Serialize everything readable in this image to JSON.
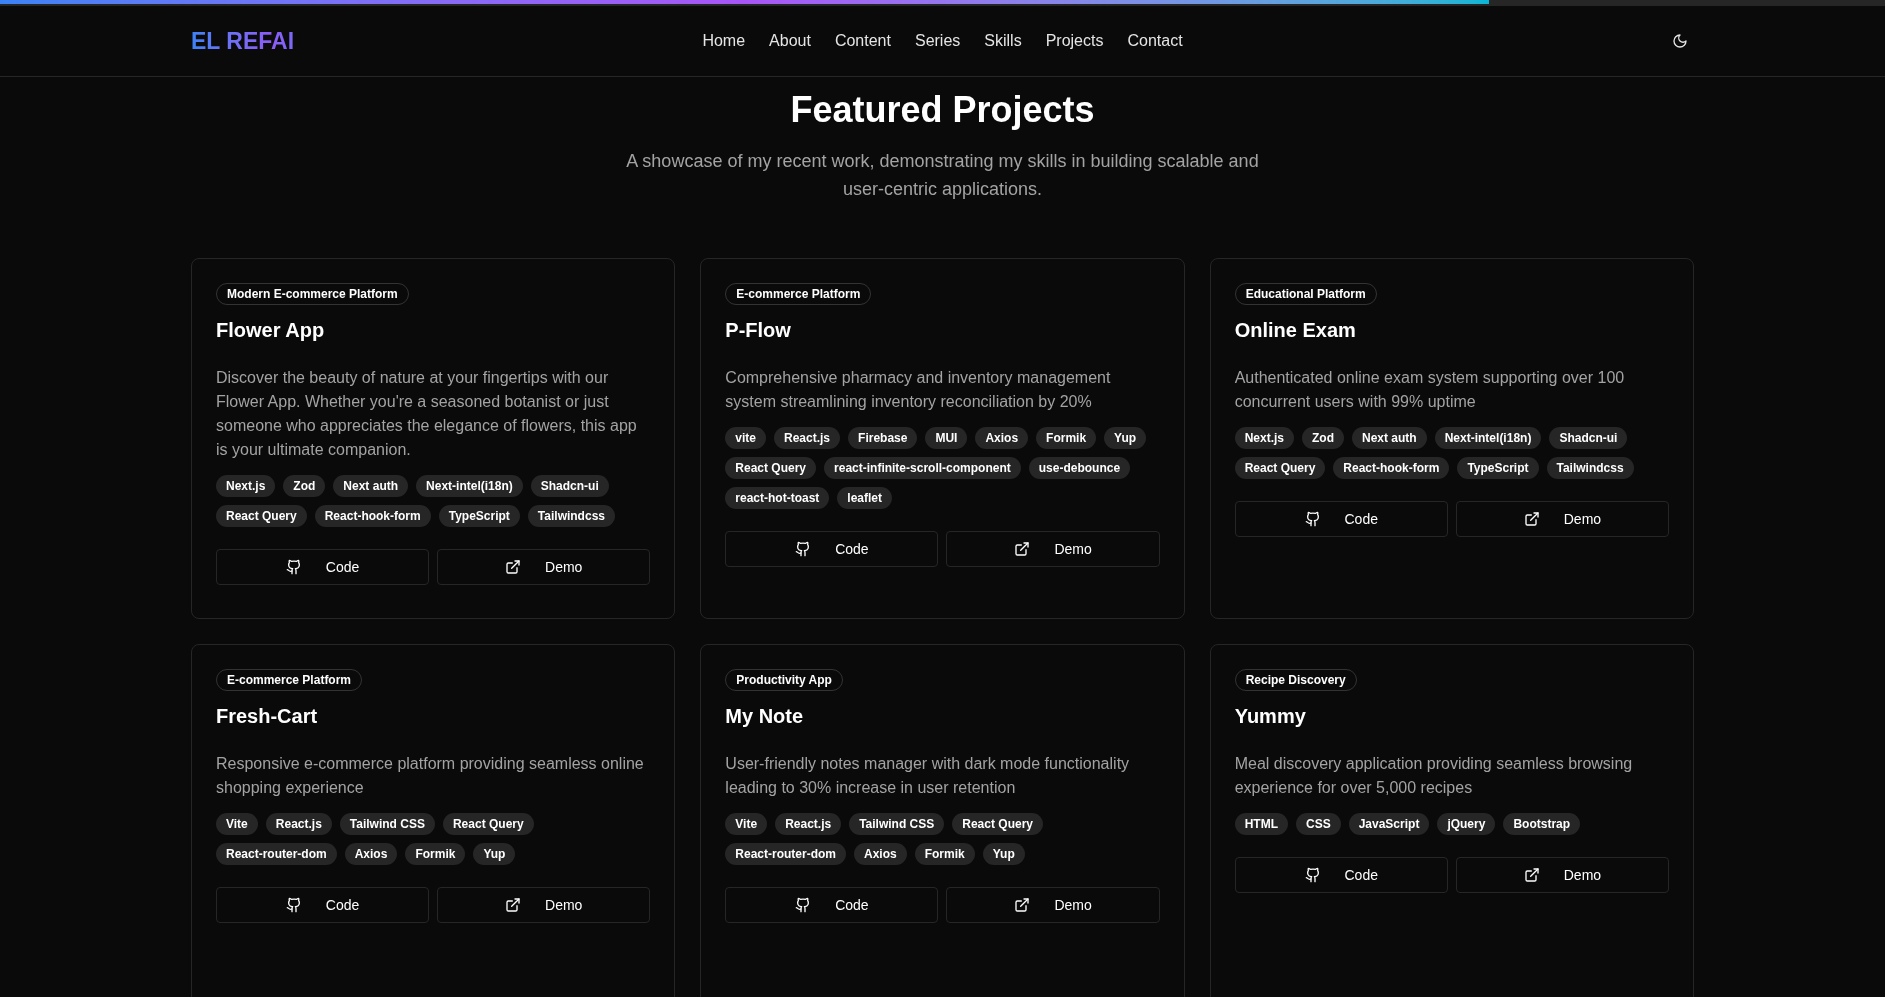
{
  "scroll_progress": {
    "level": 0.79
  },
  "header": {
    "logo": "EL REFAI",
    "nav": [
      "Home",
      "About",
      "Content",
      "Series",
      "Skills",
      "Projects",
      "Contact"
    ]
  },
  "section": {
    "title": "Featured Projects",
    "subtitle": "A showcase of my recent work, demonstrating my skills in building scalable and user-centric applications."
  },
  "projects": [
    {
      "category": "Modern E-commerce Platform",
      "title": "Flower App",
      "description": "Discover the beauty of nature at your fingertips with our Flower App. Whether you're a seasoned botanist or just someone who appreciates the elegance of flowers, this app is your ultimate companion.",
      "tags": [
        "Next.js",
        "Zod",
        "Next auth",
        "Next-intel(i18n)",
        "Shadcn-ui",
        "React Query",
        "React-hook-form",
        "TypeScript",
        "Tailwindcss"
      ],
      "buttons": [
        {
          "kind": "code",
          "label": "Code"
        },
        {
          "kind": "demo",
          "label": "Demo"
        }
      ]
    },
    {
      "category": "E-commerce Platform",
      "title": "P-Flow",
      "description": "Comprehensive pharmacy and inventory management system streamlining inventory reconciliation by 20%",
      "tags": [
        "vite",
        "React.js",
        "Firebase",
        "MUI",
        "Axios",
        "Formik",
        "Yup",
        "React Query",
        "react-infinite-scroll-component",
        "use-debounce",
        "react-hot-toast",
        "leaflet"
      ],
      "buttons": [
        {
          "kind": "code",
          "label": "Code"
        },
        {
          "kind": "demo",
          "label": "Demo"
        }
      ]
    },
    {
      "category": "Educational Platform",
      "title": "Online Exam",
      "description": "Authenticated online exam system supporting over 100 concurrent users with 99% uptime",
      "tags": [
        "Next.js",
        "Zod",
        "Next auth",
        "Next-intel(i18n)",
        "Shadcn-ui",
        "React Query",
        "React-hook-form",
        "TypeScript",
        "Tailwindcss"
      ],
      "buttons": [
        {
          "kind": "code",
          "label": "Code"
        },
        {
          "kind": "demo",
          "label": "Demo"
        }
      ]
    },
    {
      "category": "E-commerce Platform",
      "title": "Fresh-Cart",
      "description": "Responsive e-commerce platform providing seamless online shopping experience",
      "tags": [
        "Vite",
        "React.js",
        "Tailwind CSS",
        "React Query",
        "React-router-dom",
        "Axios",
        "Formik",
        "Yup"
      ],
      "buttons": [
        {
          "kind": "code",
          "label": "Code"
        },
        {
          "kind": "demo",
          "label": "Demo"
        }
      ]
    },
    {
      "category": "Productivity App",
      "title": "My Note",
      "description": "User-friendly notes manager with dark mode functionality leading to 30% increase in user retention",
      "tags": [
        "Vite",
        "React.js",
        "Tailwind CSS",
        "React Query",
        "React-router-dom",
        "Axios",
        "Formik",
        "Yup"
      ],
      "buttons": [
        {
          "kind": "code",
          "label": "Code"
        },
        {
          "kind": "demo",
          "label": "Demo"
        }
      ]
    },
    {
      "category": "Recipe Discovery",
      "title": "Yummy",
      "description": "Meal discovery application providing seamless browsing experience for over 5,000 recipes",
      "tags": [
        "HTML",
        "CSS",
        "JavaScript",
        "jQuery",
        "Bootstrap"
      ],
      "buttons": [
        {
          "kind": "code",
          "label": "Code"
        },
        {
          "kind": "demo",
          "label": "Demo"
        }
      ]
    }
  ]
}
